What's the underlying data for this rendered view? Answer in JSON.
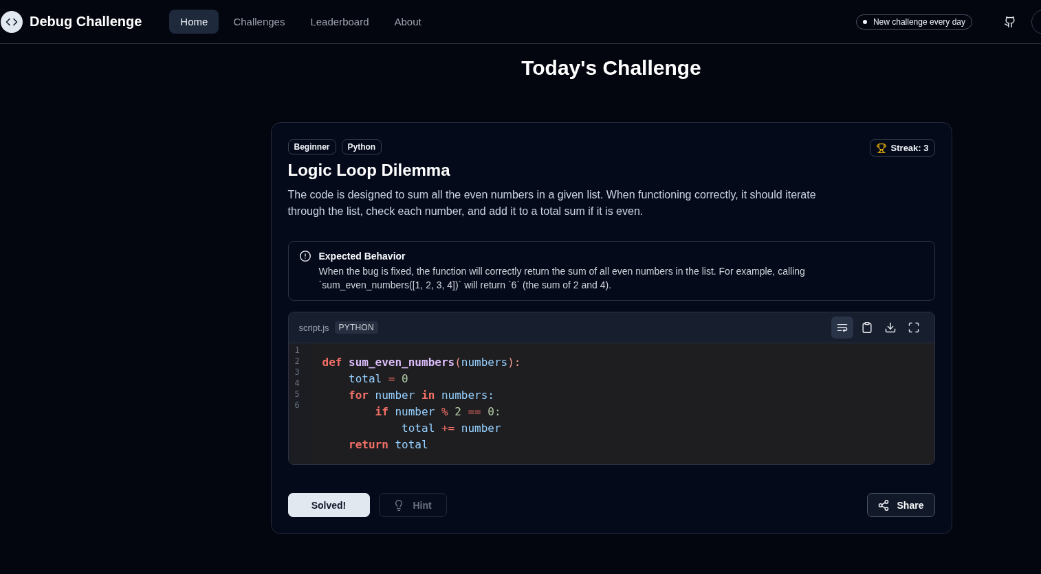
{
  "header": {
    "brand": "Debug Challenge",
    "nav": [
      {
        "label": "Home",
        "selected": true
      },
      {
        "label": "Challenges",
        "selected": false
      },
      {
        "label": "Leaderboard",
        "selected": false
      },
      {
        "label": "About",
        "selected": false
      }
    ],
    "announcement": "New challenge every day"
  },
  "page_title": "Today's Challenge",
  "challenge": {
    "tags": [
      "Beginner",
      "Python"
    ],
    "streak": "Streak: 3",
    "title": "Logic Loop Dilemma",
    "description": "The code is designed to sum all the even numbers in a given list. When functioning correctly, it should iterate through the list, check each number, and add it to a total sum if it is even.",
    "expected": {
      "title": "Expected Behavior",
      "text": "When the bug is fixed, the function will correctly return the sum of all even numbers in the list. For example, calling `sum_even_numbers([1, 2, 3, 4])` will return `6` (the sum of 2 and 4)."
    },
    "code": {
      "filename": "script.js",
      "language": "PYTHON",
      "toolbar": [
        {
          "kind": "wrap",
          "selected": true
        },
        {
          "kind": "copy",
          "selected": false
        },
        {
          "kind": "download",
          "selected": false
        },
        {
          "kind": "fullscreen",
          "selected": false
        }
      ],
      "line_numbers": [
        "1",
        "2",
        "3",
        "4",
        "5",
        "6"
      ],
      "lines": [
        [
          {
            "text": "def ",
            "kind": "keyword"
          },
          {
            "text": "sum_even_numbers",
            "kind": "function"
          },
          {
            "text": "(",
            "kind": "punct"
          },
          {
            "text": "numbers",
            "kind": "variable"
          },
          {
            "text": "):",
            "kind": "punct"
          }
        ],
        [
          {
            "text": "    total ",
            "kind": "variable"
          },
          {
            "text": "= ",
            "kind": "operator"
          },
          {
            "text": "0",
            "kind": "number"
          }
        ],
        [
          {
            "text": "    for ",
            "kind": "keyword"
          },
          {
            "text": "number ",
            "kind": "variable"
          },
          {
            "text": "in ",
            "kind": "keyword"
          },
          {
            "text": "numbers:",
            "kind": "variable"
          }
        ],
        [
          {
            "text": "        if ",
            "kind": "keyword"
          },
          {
            "text": "number ",
            "kind": "variable"
          },
          {
            "text": "% ",
            "kind": "operator"
          },
          {
            "text": "2 ",
            "kind": "number"
          },
          {
            "text": "== ",
            "kind": "operator"
          },
          {
            "text": "0:",
            "kind": "number"
          }
        ],
        [
          {
            "text": "            total ",
            "kind": "variable"
          },
          {
            "text": "+= ",
            "kind": "operator"
          },
          {
            "text": "number",
            "kind": "variable"
          }
        ],
        [
          {
            "text": "    return ",
            "kind": "keyword"
          },
          {
            "text": "total",
            "kind": "variable"
          }
        ]
      ]
    },
    "actions": [
      {
        "label": "Solved!",
        "kind": "primary",
        "disabled": false
      },
      {
        "label": "Hint",
        "kind": "hint",
        "disabled": true
      },
      {
        "label": "Share",
        "kind": "share",
        "disabled": false
      }
    ]
  }
}
